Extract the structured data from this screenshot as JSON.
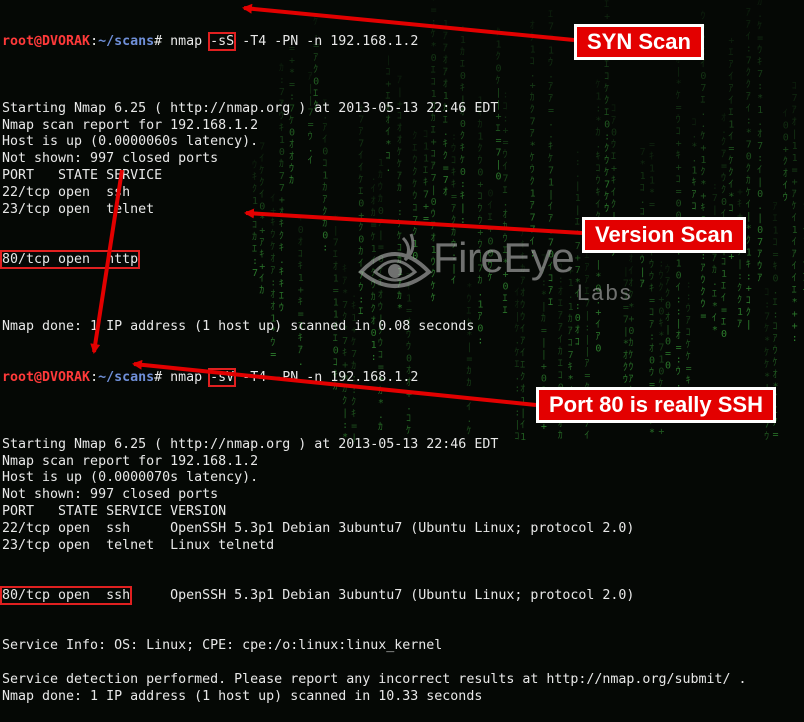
{
  "scan1": {
    "prompt": {
      "user": "root@DVORAK",
      "sep": ":",
      "path": "~/scans",
      "symbol": "# "
    },
    "command": {
      "pre": "nmap ",
      "flag": "-sS",
      "post": " -T4 -PN -n 192.168.1.2"
    },
    "output": [
      "",
      "Starting Nmap 6.25 ( http://nmap.org ) at 2013-05-13 22:46 EDT",
      "Nmap scan report for 192.168.1.2",
      "Host is up (0.0000060s latency).",
      "Not shown: 997 closed ports",
      "PORT   STATE SERVICE",
      "22/tcp open  ssh",
      "23/tcp open  telnet"
    ],
    "highlighted_row": "80/tcp open  http",
    "output_after": [
      "",
      "Nmap done: 1 IP address (1 host up) scanned in 0.08 seconds"
    ]
  },
  "scan2": {
    "prompt": {
      "user": "root@DVORAK",
      "sep": ":",
      "path": "~/scans",
      "symbol": "# "
    },
    "command": {
      "pre": "nmap ",
      "flag": "-sV",
      "post": " -T4 -PN -n 192.168.1.2"
    },
    "output": [
      "",
      "Starting Nmap 6.25 ( http://nmap.org ) at 2013-05-13 22:46 EDT",
      "Nmap scan report for 192.168.1.2",
      "Host is up (0.0000070s latency).",
      "Not shown: 997 closed ports",
      "PORT   STATE SERVICE VERSION",
      "22/tcp open  ssh     OpenSSH 5.3p1 Debian 3ubuntu7 (Ubuntu Linux; protocol 2.0)",
      "23/tcp open  telnet  Linux telnetd"
    ],
    "highlighted_row": "80/tcp open  ssh",
    "highlighted_row_rest": "     OpenSSH 5.3p1 Debian 3ubuntu7 (Ubuntu Linux; protocol 2.0)",
    "output_after": [
      "Service Info: OS: Linux; CPE: cpe:/o:linux:linux_kernel",
      "",
      "Service detection performed. Please report any incorrect results at http://nmap.org/submit/ .",
      "Nmap done: 1 IP address (1 host up) scanned in 10.33 seconds"
    ]
  },
  "callouts": {
    "syn": "SYN Scan",
    "version": "Version Scan",
    "port80": "Port 80 is really SSH"
  },
  "watermark": {
    "brand": "FireEye",
    "sub": "Labs"
  },
  "colors": {
    "callout_bg": "#e30000",
    "prompt_user": "#ff3a3a",
    "prompt_path": "#6f8fd8",
    "matrix_green": "#2f8f2f"
  }
}
